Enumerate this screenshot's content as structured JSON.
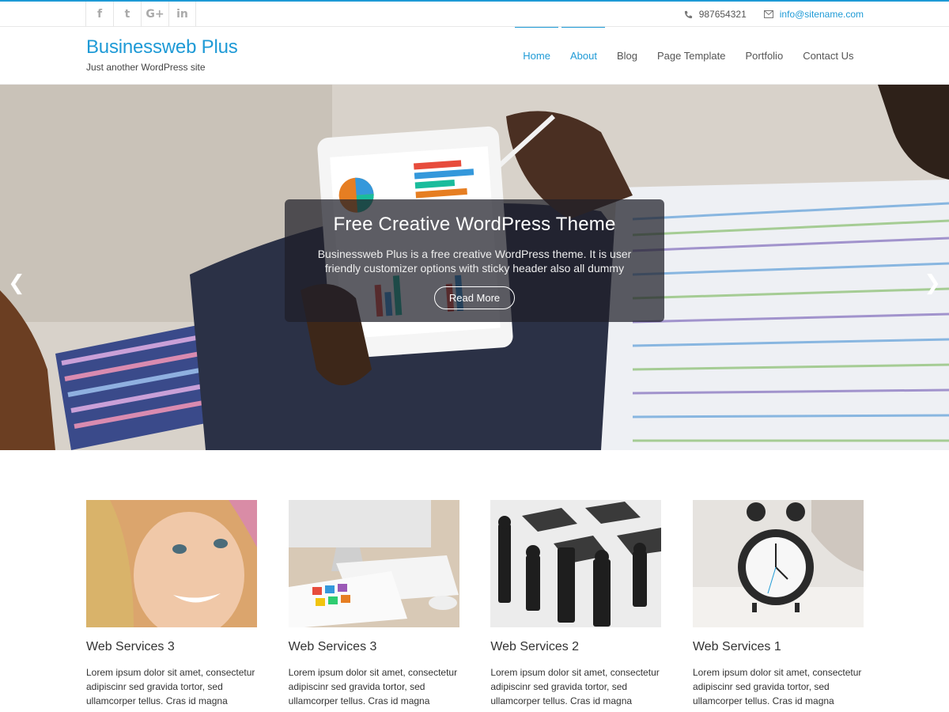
{
  "topbar": {
    "social": [
      {
        "icon": "facebook-icon",
        "glyph": "f"
      },
      {
        "icon": "twitter-icon",
        "glyph": "t"
      },
      {
        "icon": "google-plus-icon",
        "glyph": "G+"
      },
      {
        "icon": "linkedin-icon",
        "glyph": "in"
      }
    ],
    "phone": "987654321",
    "email": "info@sitename.com"
  },
  "header": {
    "title": "Businessweb Plus",
    "tagline": "Just another WordPress site"
  },
  "nav": {
    "items": [
      {
        "label": "Home"
      },
      {
        "label": "About"
      },
      {
        "label": "Blog"
      },
      {
        "label": "Page Template"
      },
      {
        "label": "Portfolio"
      },
      {
        "label": "Contact Us"
      }
    ]
  },
  "slider": {
    "title": "Free Creative WordPress Theme",
    "text": "Businessweb Plus is a free creative WordPress theme. It is user friendly customizer options with sticky header also all dummy",
    "button": "Read More",
    "prev_glyph": "❮",
    "next_glyph": "❯"
  },
  "services": [
    {
      "title": "Web Services 3",
      "text": "Lorem ipsum dolor sit amet, consectetur adipiscinr sed gravida tortor, sed ullamcorper tellus. Cras id magna tempor,"
    },
    {
      "title": "Web Services 3",
      "text": "Lorem ipsum dolor sit amet, consectetur adipiscinr sed gravida tortor, sed ullamcorper tellus. Cras id magna tempor,"
    },
    {
      "title": "Web Services 2",
      "text": "Lorem ipsum dolor sit amet, consectetur adipiscinr sed gravida tortor, sed ullamcorper tellus. Cras id magna tempor,"
    },
    {
      "title": "Web Services 1",
      "text": "Lorem ipsum dolor sit amet, consectetur adipiscinr sed gravida tortor, sed ullamcorper tellus. Cras id magna tempor,"
    }
  ],
  "colors": {
    "accent": "#1e9ad6"
  }
}
